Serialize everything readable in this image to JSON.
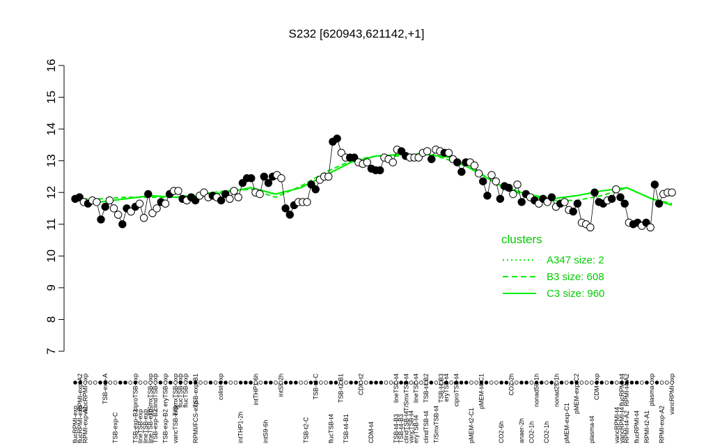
{
  "chart_data": {
    "type": "line",
    "title": "S232 [620943,621142,+1]",
    "xlabel": "",
    "ylabel": "",
    "ylim": [
      7,
      16
    ],
    "yticks": [
      7,
      8,
      9,
      10,
      11,
      12,
      13,
      14,
      15,
      16
    ],
    "n_samples": 120,
    "grid": false,
    "colors": {
      "cluster_line": "#00ee00",
      "legend_text": "#00cc00",
      "point_edge": "#000000",
      "point_dark": "#000000",
      "point_light": "#ffffff"
    },
    "legend": {
      "title": "clusters",
      "position": "right",
      "entries": [
        {
          "label": "A347 size: 2",
          "style": "dotted"
        },
        {
          "label": "B3 size: 608",
          "style": "dashed"
        },
        {
          "label": "C3 size: 960",
          "style": "solid"
        }
      ]
    },
    "top_labels": [
      {
        "i": 1,
        "text": "RPMI-exp-A2"
      },
      {
        "i": 2,
        "text": "vancRPMI-exp"
      },
      {
        "i": 6,
        "text": "TSB-exp-A"
      },
      {
        "i": 12,
        "text": "ciproTSB-exp"
      },
      {
        "i": 15,
        "text": "T/SmxTSB-exp"
      },
      {
        "i": 16,
        "text": "clindTSB-exp"
      },
      {
        "i": 18,
        "text": "eryTSB-exp"
      },
      {
        "i": 20,
        "text": "T/SmxTSB-exp"
      },
      {
        "i": 21,
        "text": "flucTSB-exp"
      },
      {
        "i": 22,
        "text": "flucTSB-exp"
      },
      {
        "i": 24,
        "text": "TSB-exp-B1"
      },
      {
        "i": 29,
        "text": "colist-exp"
      },
      {
        "i": 36,
        "text": "intTHP1-6h"
      },
      {
        "i": 41,
        "text": "intS9-2h"
      },
      {
        "i": 48,
        "text": "TSB-t4-C"
      },
      {
        "i": 53,
        "text": "TSB-t2-B1"
      },
      {
        "i": 57,
        "text": "CDM-t2"
      },
      {
        "i": 64,
        "text": "lineTSB-t4"
      },
      {
        "i": 66,
        "text": "T/SmxTSB-t4"
      },
      {
        "i": 68,
        "text": "lineTSB-t4"
      },
      {
        "i": 70,
        "text": "TSB-t4-B2"
      },
      {
        "i": 73,
        "text": "TSB-t4-B3"
      },
      {
        "i": 74,
        "text": "eryTSB-t4"
      },
      {
        "i": 76,
        "text": "ciproTSB-t4"
      },
      {
        "i": 81,
        "text": "pMEM-t4-C1"
      },
      {
        "i": 87,
        "text": "CO2-2h"
      },
      {
        "i": 92,
        "text": "nonad50-1h"
      },
      {
        "i": 96,
        "text": "nonad25-1h"
      },
      {
        "i": 100,
        "text": "pMEM-exp-C2"
      },
      {
        "i": 104,
        "text": "CDM-exp"
      },
      {
        "i": 109,
        "text": "flucRPMI-t4"
      },
      {
        "i": 110,
        "text": "RPMI-t4-A2"
      },
      {
        "i": 115,
        "text": "plasma-exp"
      },
      {
        "i": 119,
        "text": "vancRPMI-exp"
      }
    ],
    "bottom_labels": [
      {
        "i": 0,
        "text": "flucRPMI-exp"
      },
      {
        "i": 1,
        "text": "flucRPMI-exp"
      },
      {
        "i": 2,
        "text": "RPMI-exp-A1"
      },
      {
        "i": 8,
        "text": "TSB-exp-C"
      },
      {
        "i": 12,
        "text": "TSB-exp-B3"
      },
      {
        "i": 13,
        "text": "lineTSB-exp"
      },
      {
        "i": 14,
        "text": "lineTSB-exp"
      },
      {
        "i": 15,
        "text": "lineTSB-exp"
      },
      {
        "i": 16,
        "text": "TSB-exp-B2"
      },
      {
        "i": 18,
        "text": "TSB-exp-B2"
      },
      {
        "i": 20,
        "text": "vancTSB-exp"
      },
      {
        "i": 24,
        "text": "RPMI/FCS-exp"
      },
      {
        "i": 33,
        "text": "intTHP1-2h"
      },
      {
        "i": 38,
        "text": "intS9-6h"
      },
      {
        "i": 46,
        "text": "TSB-t2-C"
      },
      {
        "i": 51,
        "text": "flucTSB-t4"
      },
      {
        "i": 54,
        "text": "TSB-t4-B1"
      },
      {
        "i": 59,
        "text": "CDM-t4"
      },
      {
        "i": 64,
        "text": "TSB-t4-B3"
      },
      {
        "i": 65,
        "text": "TSB-t4-B3"
      },
      {
        "i": 66,
        "text": "clindTSB-t4"
      },
      {
        "i": 67,
        "text": "vancTSB-t4"
      },
      {
        "i": 68,
        "text": "eryTSB-t4"
      },
      {
        "i": 70,
        "text": "clindTSB-t4"
      },
      {
        "i": 72,
        "text": "T/SmxTSB-t4"
      },
      {
        "i": 79,
        "text": "pMEM-t2-C1"
      },
      {
        "i": 85,
        "text": "CO2-6h"
      },
      {
        "i": 89,
        "text": "anaer-2h"
      },
      {
        "i": 91,
        "text": "CO2-1h"
      },
      {
        "i": 94,
        "text": "CO2-1h"
      },
      {
        "i": 98,
        "text": "pMEM-exp-C1"
      },
      {
        "i": 103,
        "text": "plasma-t4"
      },
      {
        "i": 108,
        "text": "vancRPMI-t4"
      },
      {
        "i": 109,
        "text": "vancRPMI-t4"
      },
      {
        "i": 110,
        "text": "RPMI-t4-A2"
      },
      {
        "i": 112,
        "text": "flucRPMI-t4"
      },
      {
        "i": 114,
        "text": "RPMI-t2-A1"
      },
      {
        "i": 117,
        "text": "RPMI-exp-A2"
      }
    ],
    "series": [
      {
        "values": [
          11.8,
          11.85,
          11.7,
          11.65,
          11.75,
          11.7,
          11.15,
          11.55,
          11.75,
          11.5,
          11.3,
          11.0,
          11.5,
          11.4,
          11.55,
          11.65,
          11.2,
          11.95,
          11.35,
          11.5,
          11.7,
          11.65,
          11.95,
          12.05,
          12.05,
          11.8,
          11.75,
          11.85,
          11.75,
          11.9,
          12.0,
          11.85,
          11.9,
          11.85,
          11.75,
          11.95,
          11.8,
          12.05,
          11.85,
          12.3,
          12.45,
          12.45,
          12.0,
          11.95,
          12.5,
          12.3,
          12.5,
          12.55,
          12.45,
          11.5,
          11.3,
          11.6,
          11.7,
          11.7,
          11.7,
          12.25,
          12.1,
          12.4,
          12.5,
          12.5,
          13.6,
          13.7,
          13.25,
          13.1,
          13.1,
          13.1,
          12.95,
          12.9,
          12.95,
          12.75,
          12.7,
          12.7,
          13.1,
          13.05,
          12.95,
          13.35,
          13.3,
          13.15,
          13.1,
          13.1,
          13.1,
          13.25,
          13.3,
          13.05,
          13.35,
          13.3,
          13.25,
          13.25,
          13.05,
          12.95,
          12.65,
          12.95,
          12.95,
          12.85,
          12.6,
          12.35,
          11.9,
          12.55,
          12.35,
          11.8,
          12.2,
          12.15,
          11.95,
          12.25,
          11.7,
          11.95,
          11.85,
          11.75,
          11.65,
          11.8,
          11.7,
          11.85,
          11.55,
          11.65,
          11.7,
          11.45,
          11.4,
          11.65,
          11.05,
          11.0,
          10.9,
          12.0,
          11.7,
          11.65,
          11.75,
          11.8,
          12.1,
          11.85,
          11.65,
          11.05,
          11.0,
          11.05,
          10.95,
          11.05,
          10.9,
          12.25,
          11.65,
          11.95,
          12.0,
          12.0
        ],
        "fills": [
          "d",
          "d",
          "l",
          "d",
          "l",
          "l",
          "d",
          "d",
          "l",
          "l",
          "l",
          "d",
          "d",
          "l",
          "d",
          "l",
          "l",
          "d",
          "l",
          "l",
          "d",
          "l",
          "d",
          "l",
          "l",
          "d",
          "l",
          "d",
          "d",
          "l",
          "l",
          "l",
          "d",
          "l",
          "d",
          "d",
          "l",
          "l",
          "l",
          "d",
          "d",
          "d",
          "l",
          "l",
          "d",
          "d",
          "d",
          "l",
          "l",
          "d",
          "d",
          "d",
          "l",
          "l",
          "l",
          "d",
          "d",
          "l",
          "l",
          "l",
          "d",
          "d",
          "l",
          "l",
          "d",
          "d",
          "l",
          "l",
          "l",
          "d",
          "d",
          "d",
          "l",
          "l",
          "l",
          "l",
          "d",
          "d",
          "l",
          "l",
          "l",
          "l",
          "l",
          "d",
          "l",
          "l",
          "d",
          "l",
          "l",
          "d",
          "d",
          "d",
          "l",
          "l",
          "l",
          "d",
          "d",
          "l",
          "l",
          "d",
          "d",
          "d",
          "l",
          "l",
          "d",
          "d",
          "l",
          "d",
          "l",
          "d",
          "l",
          "d",
          "l",
          "d",
          "l",
          "l",
          "d",
          "d",
          "l",
          "l",
          "l",
          "d",
          "d",
          "d",
          "l",
          "d",
          "l",
          "d",
          "d",
          "l",
          "d",
          "d",
          "l",
          "d",
          "l",
          "d",
          "d",
          "l",
          "l",
          "l",
          "l"
        ]
      }
    ],
    "cluster_lines": {
      "C3": [
        [
          0,
          11.75
        ],
        [
          5,
          11.7
        ],
        [
          10,
          11.8
        ],
        [
          15,
          11.9
        ],
        [
          20,
          11.85
        ],
        [
          25,
          11.9
        ],
        [
          30,
          12.0
        ],
        [
          35,
          12.15
        ],
        [
          40,
          11.95
        ],
        [
          45,
          12.15
        ],
        [
          50,
          12.55
        ],
        [
          55,
          12.95
        ],
        [
          60,
          13.15
        ],
        [
          65,
          13.2
        ],
        [
          70,
          13.2
        ],
        [
          75,
          13.1
        ],
        [
          80,
          12.65
        ],
        [
          85,
          12.2
        ],
        [
          90,
          11.95
        ],
        [
          95,
          11.8
        ],
        [
          100,
          11.9
        ],
        [
          105,
          12.05
        ],
        [
          110,
          12.15
        ],
        [
          115,
          11.8
        ],
        [
          119,
          11.6
        ]
      ],
      "B3": [
        [
          0,
          11.8
        ],
        [
          5,
          11.8
        ],
        [
          10,
          11.85
        ],
        [
          15,
          11.85
        ],
        [
          20,
          11.85
        ],
        [
          25,
          11.95
        ],
        [
          30,
          12.05
        ],
        [
          35,
          12.1
        ],
        [
          40,
          11.85
        ],
        [
          45,
          12.2
        ],
        [
          50,
          12.65
        ],
        [
          55,
          13.0
        ],
        [
          60,
          13.15
        ],
        [
          65,
          13.15
        ],
        [
          70,
          13.25
        ],
        [
          75,
          13.0
        ],
        [
          80,
          12.7
        ],
        [
          85,
          12.15
        ],
        [
          90,
          11.9
        ],
        [
          95,
          11.75
        ],
        [
          100,
          11.75
        ],
        [
          105,
          11.9
        ],
        [
          110,
          12.15
        ],
        [
          115,
          11.8
        ],
        [
          119,
          11.65
        ]
      ]
    }
  }
}
